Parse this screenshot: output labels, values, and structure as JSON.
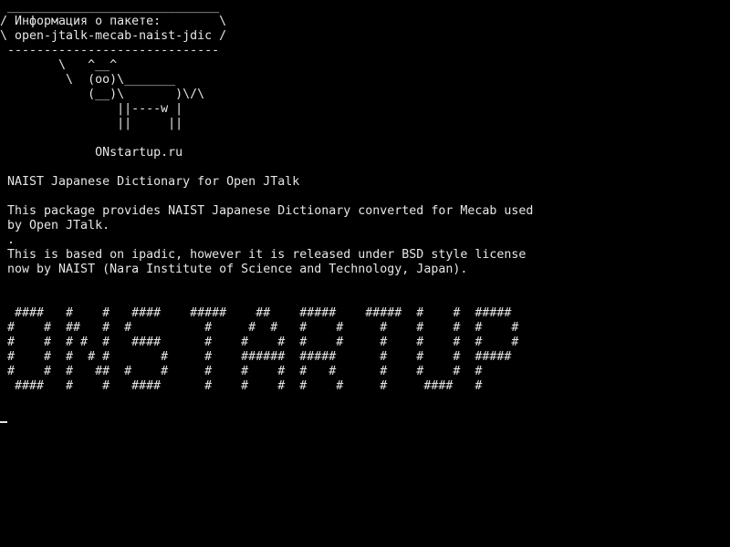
{
  "terminal": {
    "colors": {
      "background": "#000000",
      "foreground": "#e6e6e6"
    },
    "lines": [
      " _____________________________",
      "/ Информация о пакете:        \\",
      "\\ open-jtalk-mecab-naist-jdic /",
      " -----------------------------",
      "        \\   ^__^",
      "         \\  (oo)\\_______",
      "            (__)\\       )\\/\\",
      "                ||----w |",
      "                ||     ||",
      "",
      "             ONstartup.ru",
      "",
      " NAIST Japanese Dictionary for Open JTalk",
      "",
      " This package provides NAIST Japanese Dictionary converted for Mecab used",
      " by Open JTalk.",
      " .",
      " This is based on ipadic, however it is released under BSD style license",
      " now by NAIST (Nara Institute of Science and Technology, Japan).",
      "",
      "",
      "  ####   #    #   ####    #####    ##    #####    #####  #    #  #####",
      " #    #  ##   #  #          #     #  #   #    #     #    #    #  #    #",
      " #    #  # #  #   ####      #    #    #  #    #     #    #    #  #    #",
      " #    #  #  # #       #     #    ######  #####      #    #    #  #####",
      " #    #  #   ##  #    #     #    #    #  #   #      #    #    #  #",
      "  ####   #    #   ####      #    #    #  #    #     #     ####   #"
    ]
  }
}
